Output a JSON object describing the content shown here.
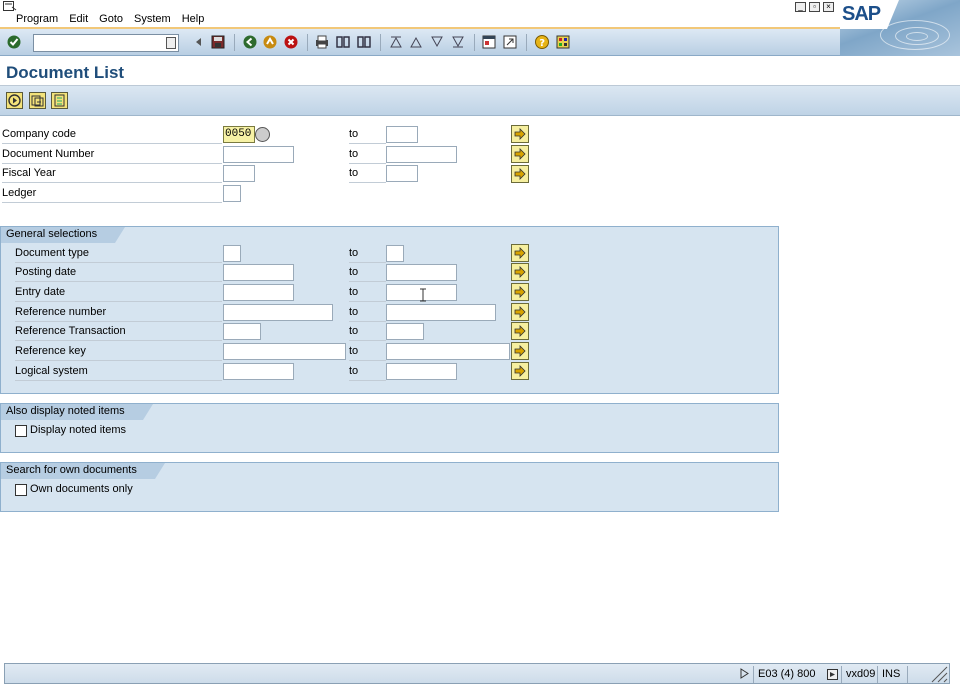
{
  "menu": [
    "Program",
    "Edit",
    "Goto",
    "System",
    "Help"
  ],
  "logo_text": "SAP",
  "page": {
    "title": "Document List"
  },
  "top_fields": [
    {
      "label": "Company code",
      "value": "0050",
      "to": "to"
    },
    {
      "label": "Document Number",
      "value": "",
      "to": "to"
    },
    {
      "label": "Fiscal Year",
      "value": "",
      "to": "to"
    },
    {
      "label": "Ledger",
      "value": ""
    }
  ],
  "general": {
    "title": "General selections",
    "rows": [
      {
        "label": "Document type",
        "to": "to"
      },
      {
        "label": "Posting date",
        "to": "to"
      },
      {
        "label": "Entry date",
        "to": "to"
      },
      {
        "label": "Reference number",
        "to": "to"
      },
      {
        "label": "Reference Transaction",
        "to": "to"
      },
      {
        "label": "Reference key",
        "to": "to"
      },
      {
        "label": "Logical system",
        "to": "to"
      }
    ]
  },
  "noted": {
    "title": "Also display noted items",
    "checkbox": "Display noted items"
  },
  "own": {
    "title": "Search for own documents",
    "checkbox": "Own documents only"
  },
  "status": {
    "system": "E03 (4) 800",
    "server": "vxd09",
    "mode": "INS"
  },
  "colors": {
    "toolbar": "#c9dbeb",
    "title": "#1f4d7a",
    "group_bg": "#d6e4f0",
    "highlight": "#f7f2a5"
  }
}
